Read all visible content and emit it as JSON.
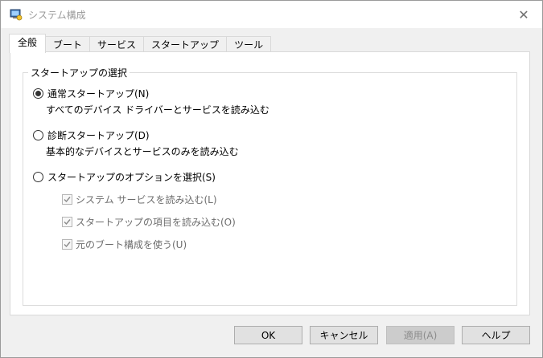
{
  "window": {
    "title": "システム構成",
    "close_glyph": "✕"
  },
  "tabs": [
    {
      "label": "全般",
      "active": true
    },
    {
      "label": "ブート",
      "active": false
    },
    {
      "label": "サービス",
      "active": false
    },
    {
      "label": "スタートアップ",
      "active": false
    },
    {
      "label": "ツール",
      "active": false
    }
  ],
  "startup_group": {
    "legend": "スタートアップの選択",
    "normal": {
      "label": "通常スタートアップ(N)",
      "description": "すべてのデバイス ドライバーとサービスを読み込む",
      "selected": true
    },
    "diagnostic": {
      "label": "診断スタートアップ(D)",
      "description": "基本的なデバイスとサービスのみを読み込む",
      "selected": false
    },
    "selective": {
      "label": "スタートアップのオプションを選択(S)",
      "selected": false,
      "options": [
        {
          "label": "システム サービスを読み込む(L)",
          "checked": true
        },
        {
          "label": "スタートアップの項目を読み込む(O)",
          "checked": true
        },
        {
          "label": "元のブート構成を使う(U)",
          "checked": true
        }
      ]
    }
  },
  "buttons": {
    "ok": "OK",
    "cancel": "キャンセル",
    "apply": "適用(A)",
    "help": "ヘルプ"
  },
  "colors": {
    "disabled_text": "#6d6d6d",
    "title_text": "#9a9a9a",
    "button_face": "#e1e1e1"
  }
}
